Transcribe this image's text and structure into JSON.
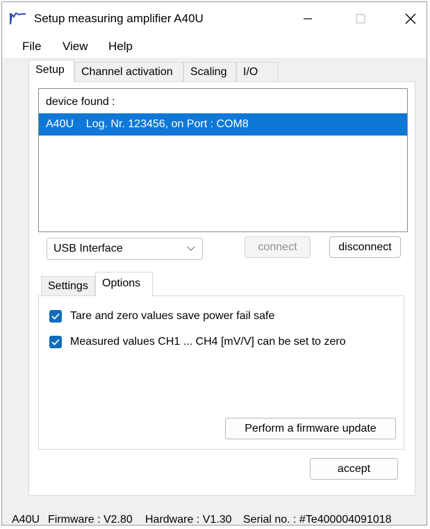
{
  "window": {
    "title": "Setup measuring amplifier A40U",
    "app_icon": "waveform-icon",
    "controls": [
      "minimize-icon",
      "maximize-icon",
      "close-icon"
    ]
  },
  "menu": [
    "File",
    "View",
    "Help"
  ],
  "tabs": {
    "items": [
      "Setup",
      "Channel activation",
      "Scaling",
      "I/O"
    ],
    "active": "Setup"
  },
  "device_list": {
    "header": "device found :",
    "rows": [
      {
        "text": "A40U    Log. Nr. 123456, on Port : COM8",
        "selected": true
      }
    ]
  },
  "interface": {
    "selected": "USB Interface",
    "connect_label": "connect",
    "connect_enabled": false,
    "disconnect_label": "disconnect"
  },
  "subtabs": {
    "items": [
      "Settings",
      "Options"
    ],
    "active": "Options"
  },
  "options": {
    "checkboxes": [
      {
        "label": "Tare and zero values save power fail safe",
        "checked": true
      },
      {
        "label": "Measured values CH1 ... CH4 [mV/V] can be set to zero",
        "checked": true
      }
    ],
    "firmware_button": "Perform a firmware update"
  },
  "accept_label": "accept",
  "status": {
    "device": "A40U",
    "firmware": "Firmware : V2.80",
    "hardware": "Hardware : V1.30",
    "serial": "Serial no. : #Te400004091018"
  },
  "colors": {
    "selection": "#0f78d7",
    "checkbox": "#0f6cbd",
    "window_bg": "#f0f0f0"
  }
}
